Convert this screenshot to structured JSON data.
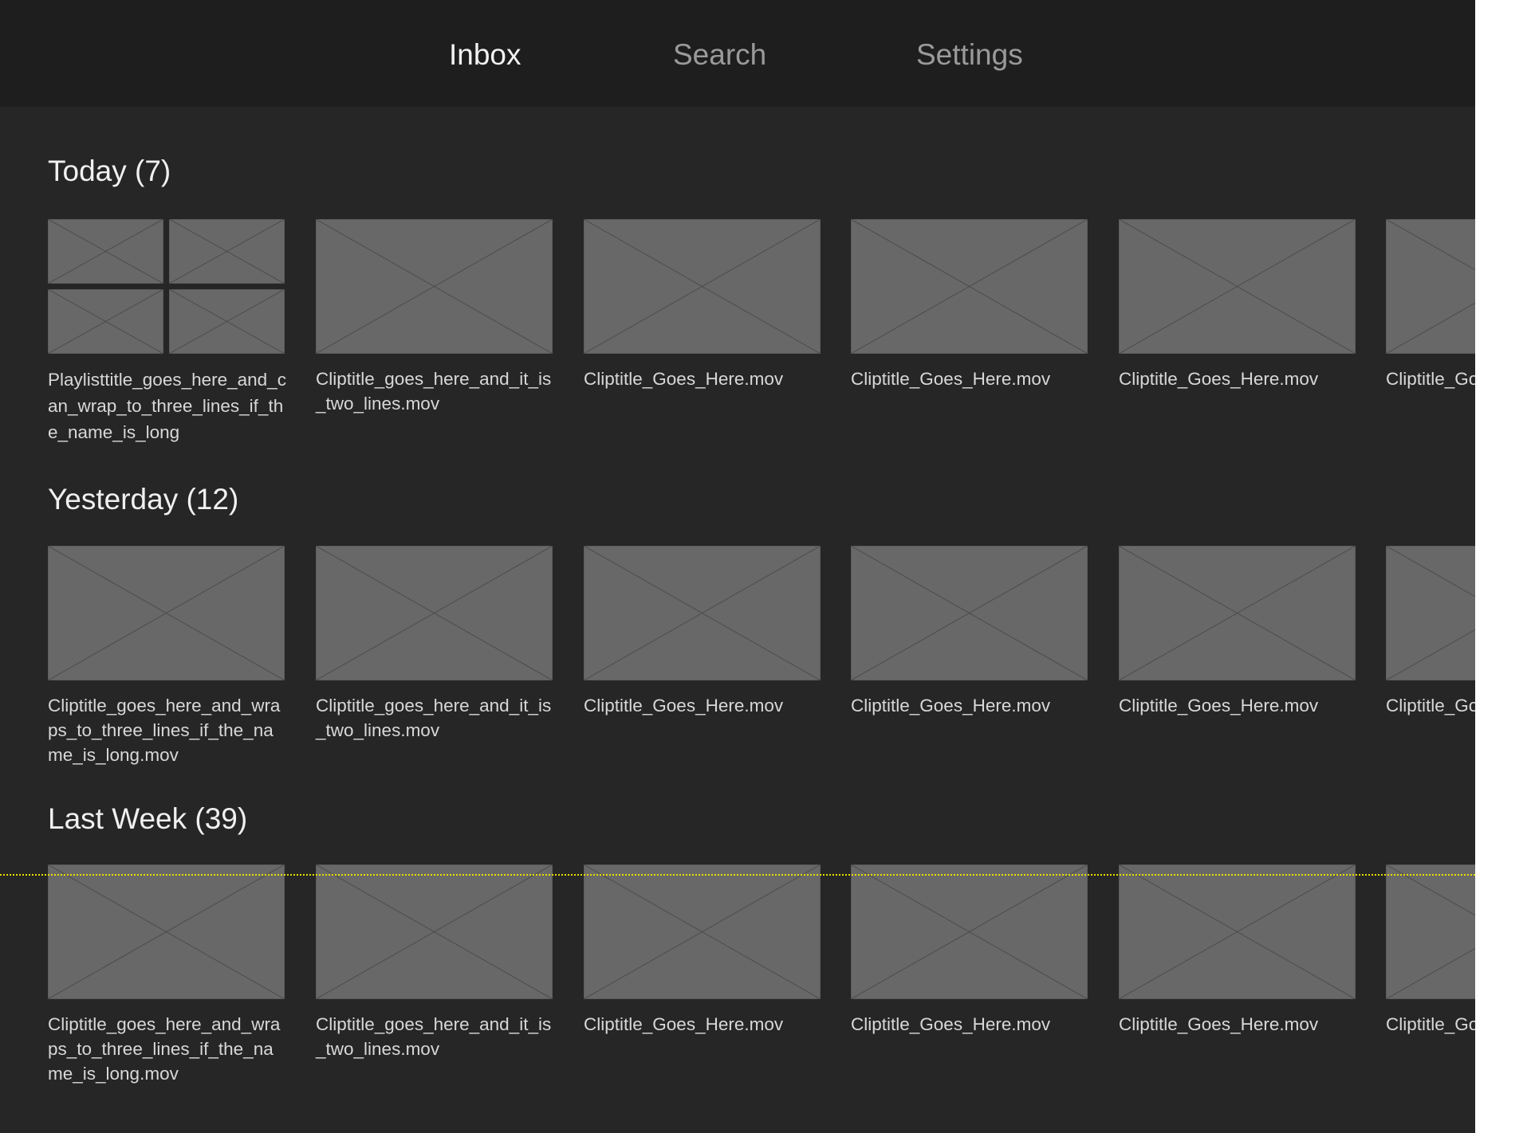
{
  "nav": {
    "tabs": [
      {
        "label": "Inbox",
        "active": true
      },
      {
        "label": "Search",
        "active": false
      },
      {
        "label": "Settings",
        "active": false
      }
    ]
  },
  "sections": [
    {
      "title": "Today (7)",
      "items": [
        {
          "title": "Playlisttitle_goes_here_and_can_wrap_to_three_lines_if_the_name_is_long",
          "kind": "playlist"
        },
        {
          "title": "Cliptitle_goes_here_and_it_is_two_lines.mov",
          "kind": "clip"
        },
        {
          "title": "Cliptitle_Goes_Here.mov",
          "kind": "clip"
        },
        {
          "title": "Cliptitle_Goes_Here.mov",
          "kind": "clip"
        },
        {
          "title": "Cliptitle_Goes_Here.mov",
          "kind": "clip"
        },
        {
          "title": "Cliptitle_Goes_Here.mov",
          "kind": "clip"
        }
      ]
    },
    {
      "title": "Yesterday (12)",
      "items": [
        {
          "title": "Cliptitle_goes_here_and_wraps_to_three_lines_if_the_name_is_long.mov",
          "kind": "clip"
        },
        {
          "title": "Cliptitle_goes_here_and_it_is_two_lines.mov",
          "kind": "clip"
        },
        {
          "title": "Cliptitle_Goes_Here.mov",
          "kind": "clip"
        },
        {
          "title": "Cliptitle_Goes_Here.mov",
          "kind": "clip"
        },
        {
          "title": "Cliptitle_Goes_Here.mov",
          "kind": "clip"
        },
        {
          "title": "Cliptitle_Goes_Here.mov",
          "kind": "clip"
        }
      ]
    },
    {
      "title": "Last Week (39)",
      "items": [
        {
          "title": "Cliptitle_goes_here_and_wraps_to_three_lines_if_the_name_is_long.mov",
          "kind": "clip"
        },
        {
          "title": "Cliptitle_goes_here_and_it_is_two_lines.mov",
          "kind": "clip"
        },
        {
          "title": "Cliptitle_Goes_Here.mov",
          "kind": "clip"
        },
        {
          "title": "Cliptitle_Goes_Here.mov",
          "kind": "clip"
        },
        {
          "title": "Cliptitle_Goes_Here.mov",
          "kind": "clip"
        },
        {
          "title": "Cliptitle_Goes_Here.mov",
          "kind": "clip"
        }
      ]
    }
  ],
  "colors": {
    "background": "#262626",
    "topbar": "#1e1e1e",
    "thumbnail": "#686868",
    "thumbnail_lines": "#4c4c4c",
    "guide_line": "#e8e000"
  }
}
